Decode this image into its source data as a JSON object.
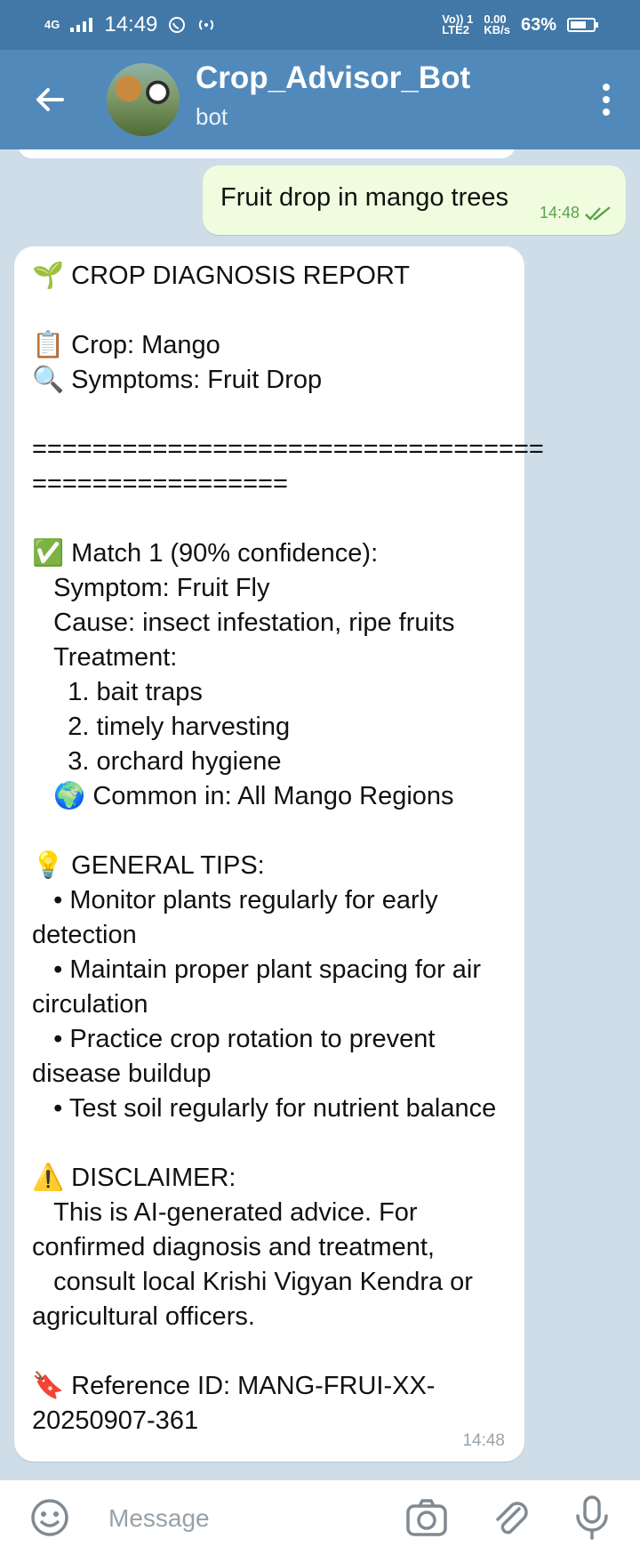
{
  "statusbar": {
    "network": "4G",
    "time": "14:49",
    "volte": "Vo)) 1\nLTE2",
    "speed": "0.00\nKB/s",
    "battery": "63%"
  },
  "header": {
    "title": "Crop_Advisor_Bot",
    "subtitle": "bot"
  },
  "chat": {
    "outgoing": {
      "text": "Fruit drop in mango trees",
      "time": "14:48"
    },
    "incoming": {
      "text": "🌱 CROP DIAGNOSIS REPORT\n\n📋 Crop: Mango\n🔍 Symptoms: Fruit Drop\n\n==================================\n=================\n\n✅ Match 1 (90% confidence):\n   Symptom: Fruit Fly\n   Cause: insect infestation, ripe fruits\n   Treatment:\n     1. bait traps\n     2. timely harvesting\n     3. orchard hygiene\n   🌍 Common in: All Mango Regions\n\n💡 GENERAL TIPS:\n   • Monitor plants regularly for early\ndetection\n   • Maintain proper plant spacing for air\ncirculation\n   • Practice crop rotation to prevent\ndisease buildup\n   • Test soil regularly for nutrient balance\n\n⚠️ DISCLAIMER:\n   This is AI-generated advice. For\nconfirmed diagnosis and treatment,\n   consult local Krishi Vigyan Kendra or\nagricultural officers.\n\n🔖 Reference ID: MANG-FRUI-XX-\n20250907-361",
      "time": "14:48"
    }
  },
  "composer": {
    "placeholder": "Message"
  },
  "colors": {
    "statusbar": "#4178a7",
    "header": "#5289bb",
    "background": "#cfdde9",
    "outgoing_bubble": "#effdde",
    "incoming_bubble": "#ffffff",
    "check": "#5aa14e"
  },
  "icons": [
    "back-arrow-icon",
    "bot-avatar",
    "more-vert-icon",
    "double-check-icon",
    "emoji-icon",
    "camera-icon",
    "paperclip-icon",
    "microphone-icon",
    "whatsapp-icon",
    "hotspot-icon",
    "battery-icon"
  ]
}
